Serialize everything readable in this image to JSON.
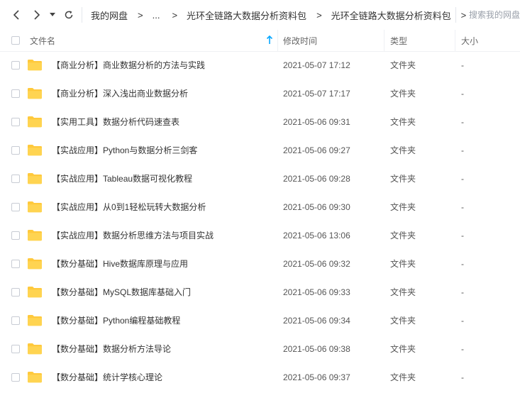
{
  "toolbar": {
    "breadcrumb": [
      "我的网盘",
      "...",
      "光环全链路大数据分析资料包",
      "光环全链路大数据分析资料包"
    ],
    "breadcrumb_sep": ">",
    "search_placeholder": "搜索我的网盘"
  },
  "columns": {
    "name": "文件名",
    "modified": "修改时间",
    "type": "类型",
    "size": "大小"
  },
  "files": [
    {
      "name": "【商业分析】商业数据分析的方法与实践",
      "modified": "2021-05-07 17:12",
      "type": "文件夹",
      "size": "-"
    },
    {
      "name": "【商业分析】深入浅出商业数据分析",
      "modified": "2021-05-07 17:17",
      "type": "文件夹",
      "size": "-"
    },
    {
      "name": "【实用工具】数据分析代码速查表",
      "modified": "2021-05-06 09:31",
      "type": "文件夹",
      "size": "-"
    },
    {
      "name": "【实战应用】Python与数据分析三剑客",
      "modified": "2021-05-06 09:27",
      "type": "文件夹",
      "size": "-"
    },
    {
      "name": "【实战应用】Tableau数据可视化教程",
      "modified": "2021-05-06 09:28",
      "type": "文件夹",
      "size": "-"
    },
    {
      "name": "【实战应用】从0到1轻松玩转大数据分析",
      "modified": "2021-05-06 09:30",
      "type": "文件夹",
      "size": "-"
    },
    {
      "name": "【实战应用】数据分析思维方法与项目实战",
      "modified": "2021-05-06 13:06",
      "type": "文件夹",
      "size": "-"
    },
    {
      "name": "【数分基础】Hive数据库原理与应用",
      "modified": "2021-05-06 09:32",
      "type": "文件夹",
      "size": "-"
    },
    {
      "name": "【数分基础】MySQL数据库基础入门",
      "modified": "2021-05-06 09:33",
      "type": "文件夹",
      "size": "-"
    },
    {
      "name": "【数分基础】Python编程基础教程",
      "modified": "2021-05-06 09:34",
      "type": "文件夹",
      "size": "-"
    },
    {
      "name": "【数分基础】数据分析方法导论",
      "modified": "2021-05-06 09:38",
      "type": "文件夹",
      "size": "-"
    },
    {
      "name": "【数分基础】统计学核心理论",
      "modified": "2021-05-06 09:37",
      "type": "文件夹",
      "size": "-"
    }
  ],
  "icons": {
    "back": "chevron-left-icon",
    "forward": "chevron-right-icon",
    "history": "caret-down-icon",
    "refresh": "refresh-icon",
    "sort": "arrow-up-icon",
    "folder": "folder-icon"
  },
  "colors": {
    "folder": "#ffc93c",
    "sort_arrow": "#06a7ff"
  }
}
